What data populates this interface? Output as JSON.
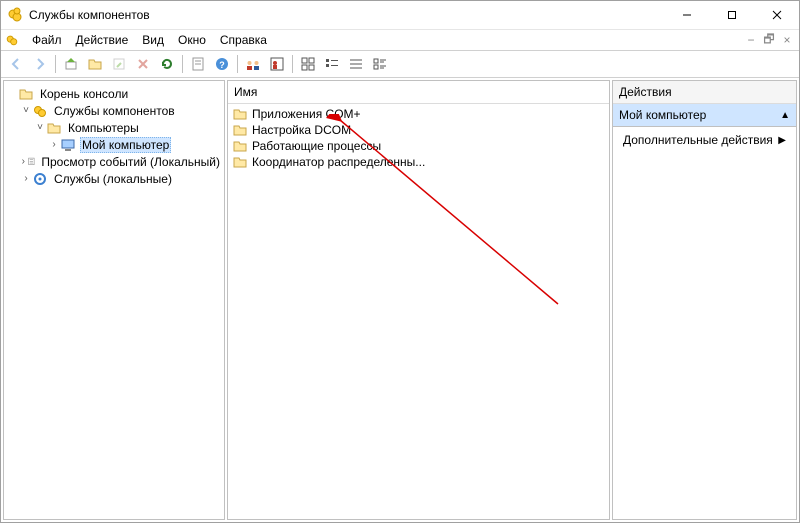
{
  "window": {
    "title": "Службы компонентов"
  },
  "menu": {
    "items": [
      "Файл",
      "Действие",
      "Вид",
      "Окно",
      "Справка"
    ]
  },
  "toolbar": {
    "icons": [
      "back-icon",
      "forward-icon",
      "sep",
      "up-icon",
      "folder-open-icon",
      "export-icon",
      "delete-icon",
      "refresh-icon",
      "sep",
      "properties-icon",
      "help-icon",
      "sep",
      "people-icon",
      "user-view-icon",
      "sep",
      "icons-view-icon",
      "list-view-icon",
      "details-view-icon",
      "tiles-view-icon"
    ]
  },
  "tree": {
    "nodes": [
      {
        "level": 1,
        "twisty": "",
        "icon": "folder-icon",
        "label": "Корень консоли",
        "selected": false
      },
      {
        "level": 2,
        "twisty": "v",
        "icon": "component-icon",
        "label": "Службы компонентов",
        "selected": false
      },
      {
        "level": 3,
        "twisty": "v",
        "icon": "folder-icon",
        "label": "Компьютеры",
        "selected": false
      },
      {
        "level": 4,
        "twisty": ">",
        "icon": "computer-icon",
        "label": "Мой компьютер",
        "selected": true
      },
      {
        "level": 2,
        "twisty": ">",
        "icon": "event-viewer-icon",
        "label": "Просмотр событий (Локальный)",
        "selected": false
      },
      {
        "level": 2,
        "twisty": ">",
        "icon": "services-icon",
        "label": "Службы (локальные)",
        "selected": false
      }
    ]
  },
  "list": {
    "header": "Имя",
    "items": [
      {
        "icon": "folder-icon",
        "label": "Приложения COM+"
      },
      {
        "icon": "folder-icon",
        "label": "Настройка DCOM"
      },
      {
        "icon": "folder-icon",
        "label": "Работающие процессы"
      },
      {
        "icon": "folder-icon",
        "label": "Координатор распределенны..."
      }
    ]
  },
  "actions": {
    "header": "Действия",
    "subheader": "Мой компьютер",
    "items": [
      {
        "label": "Дополнительные действия",
        "has_submenu": true
      }
    ]
  },
  "mdi": {
    "min": "−",
    "restore": "🗗",
    "close": "×"
  }
}
